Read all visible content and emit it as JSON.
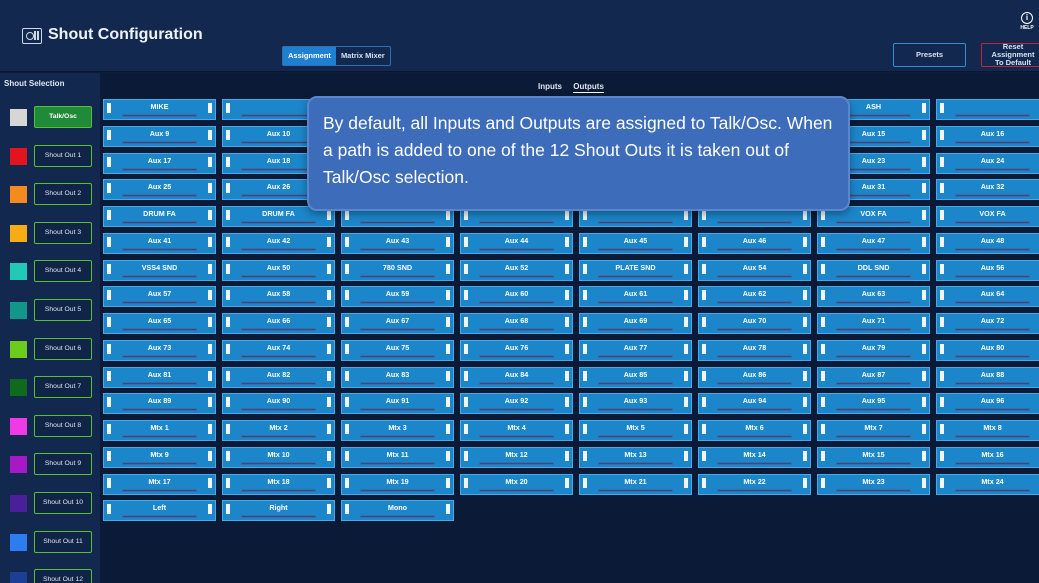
{
  "header": {
    "title": "Shout Configuration",
    "tabs": [
      "Assignment",
      "Matrix Mixer"
    ],
    "active_tab": 0,
    "presets_label": "Presets",
    "reset_label_1": "Reset Assignment",
    "reset_label_2": "To Default",
    "help_label": "HELP",
    "help_glyph": "i"
  },
  "sidebar": {
    "title": "Shout Selection",
    "items": [
      {
        "label": "Talk/Osc",
        "color": "#d6d6d6",
        "active": true
      },
      {
        "label": "Shout Out 1",
        "color": "#e2141e"
      },
      {
        "label": "Shout Out 2",
        "color": "#f58a1f"
      },
      {
        "label": "Shout Out 3",
        "color": "#f6ac16"
      },
      {
        "label": "Shout Out 4",
        "color": "#22c9b7"
      },
      {
        "label": "Shout Out 5",
        "color": "#12958a"
      },
      {
        "label": "Shout Out 6",
        "color": "#6ccb1b"
      },
      {
        "label": "Shout Out 7",
        "color": "#0f6a1e"
      },
      {
        "label": "Shout Out 8",
        "color": "#f03ae6"
      },
      {
        "label": "Shout Out 9",
        "color": "#a619c6"
      },
      {
        "label": "Shout Out 10",
        "color": "#4a1f9a"
      },
      {
        "label": "Shout Out 11",
        "color": "#2d7df0"
      },
      {
        "label": "Shout Out 12",
        "color": "#1c3f95"
      }
    ]
  },
  "io_toggle": {
    "inputs": "Inputs",
    "outputs": "Outputs",
    "active": "outputs"
  },
  "grid_rows": [
    [
      "MIKE",
      "",
      "",
      "",
      "",
      "",
      "ASH",
      ""
    ],
    [
      "Aux 9",
      "Aux 10",
      "",
      "",
      "",
      "",
      "Aux 15",
      "Aux 16"
    ],
    [
      "Aux 17",
      "Aux 18",
      "",
      "",
      "",
      "",
      "Aux 23",
      "Aux 24"
    ],
    [
      "Aux 25",
      "Aux 26",
      "",
      "",
      "",
      "",
      "Aux 31",
      "Aux 32"
    ],
    [
      "DRUM FA",
      "DRUM FA",
      "",
      "",
      "",
      "",
      "VOX FA",
      "VOX FA"
    ],
    [
      "Aux 41",
      "Aux 42",
      "Aux 43",
      "Aux 44",
      "Aux 45",
      "Aux 46",
      "Aux 47",
      "Aux 48"
    ],
    [
      "VSS4 SND",
      "Aux 50",
      "780 SND",
      "Aux 52",
      "PLATE SND",
      "Aux 54",
      "DDL SND",
      "Aux 56"
    ],
    [
      "Aux 57",
      "Aux 58",
      "Aux 59",
      "Aux 60",
      "Aux 61",
      "Aux 62",
      "Aux 63",
      "Aux 64"
    ],
    [
      "Aux 65",
      "Aux 66",
      "Aux 67",
      "Aux 68",
      "Aux 69",
      "Aux 70",
      "Aux 71",
      "Aux 72"
    ],
    [
      "Aux 73",
      "Aux 74",
      "Aux 75",
      "Aux 76",
      "Aux 77",
      "Aux 78",
      "Aux 79",
      "Aux 80"
    ],
    [
      "Aux 81",
      "Aux 82",
      "Aux 83",
      "Aux 84",
      "Aux 85",
      "Aux 86",
      "Aux 87",
      "Aux 88"
    ],
    [
      "Aux 89",
      "Aux 90",
      "Aux 91",
      "Aux 92",
      "Aux 93",
      "Aux 94",
      "Aux 95",
      "Aux 96"
    ],
    [
      "Mtx 1",
      "Mtx 2",
      "Mtx 3",
      "Mtx 4",
      "Mtx 5",
      "Mtx 6",
      "Mtx 7",
      "Mtx 8"
    ],
    [
      "Mtx 9",
      "Mtx 10",
      "Mtx 11",
      "Mtx 12",
      "Mtx 13",
      "Mtx 14",
      "Mtx 15",
      "Mtx 16"
    ],
    [
      "Mtx 17",
      "Mtx 18",
      "Mtx 19",
      "Mtx 20",
      "Mtx 21",
      "Mtx 22",
      "Mtx 23",
      "Mtx 24"
    ],
    [
      "Left",
      "Right",
      "Mono"
    ]
  ],
  "callout": {
    "text": "By default, all Inputs and Outputs are assigned to Talk/Osc. When a path is added to one of the 12 Shout Outs it is taken out of Talk/Osc selection."
  }
}
